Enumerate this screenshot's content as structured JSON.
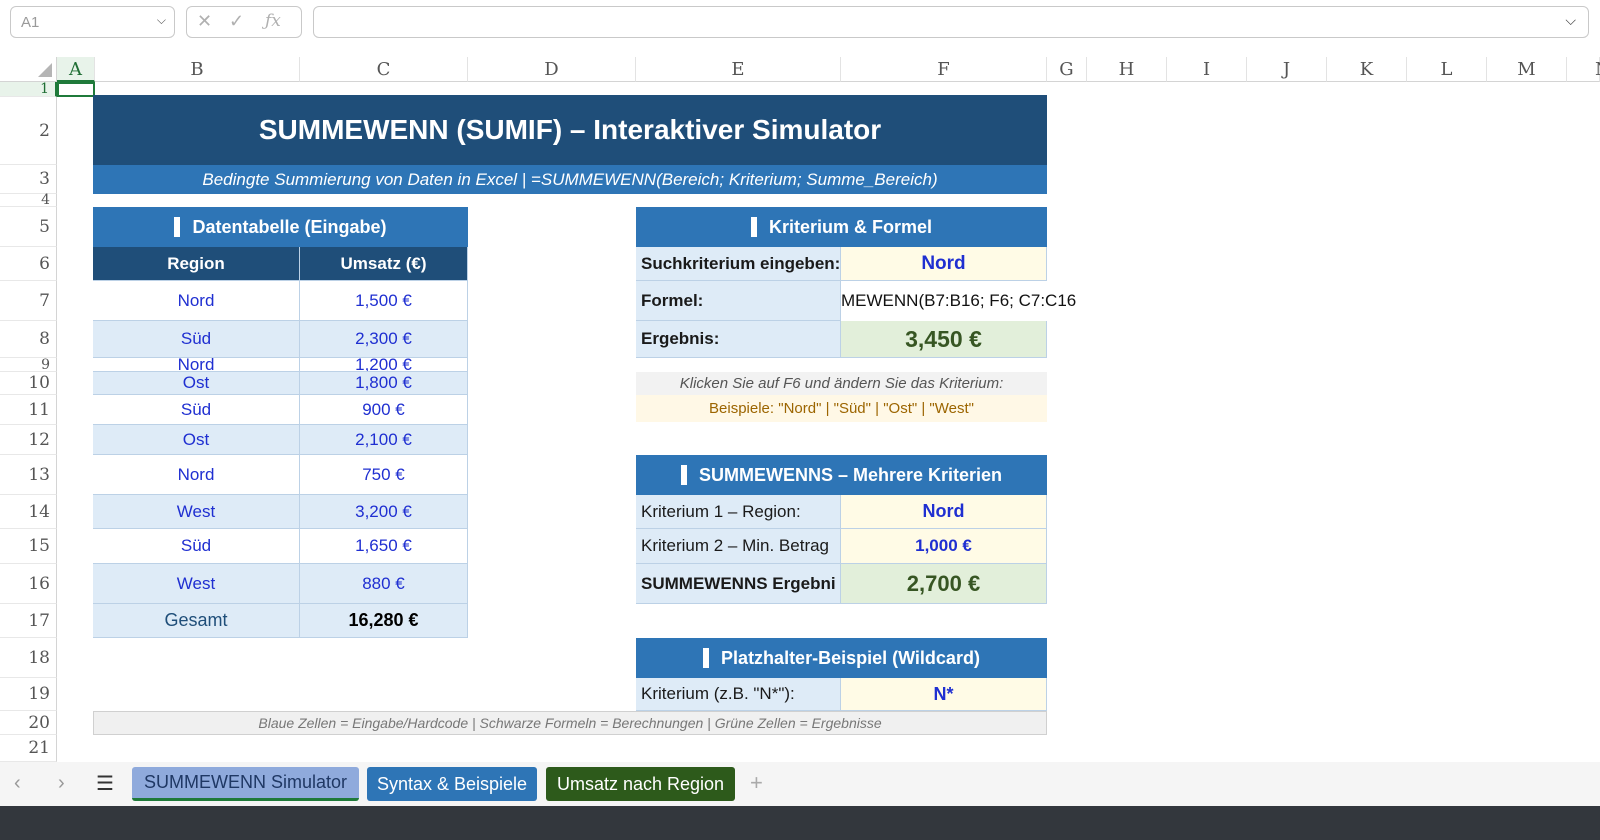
{
  "formula_bar": {
    "name_box": "A1",
    "formula": ""
  },
  "columns": [
    "A",
    "B",
    "C",
    "D",
    "E",
    "F",
    "G",
    "H",
    "I",
    "J",
    "K",
    "L",
    "M",
    "N"
  ],
  "rows": [
    "1",
    "2",
    "3",
    "4",
    "5",
    "6",
    "7",
    "8",
    "9",
    "10",
    "11",
    "12",
    "13",
    "14",
    "15",
    "16",
    "17",
    "18",
    "19",
    "20",
    "21"
  ],
  "title": "SUMMEWENN (SUMIF) – Interaktiver Simulator",
  "subtitle": "Bedingte Summierung von Daten in Excel  |  =SUMMEWENN(Bereich; Kriterium; Summe_Bereich)",
  "data_table": {
    "heading": "Datentabelle (Eingabe)",
    "col_region": "Region",
    "col_umsatz": "Umsatz (€)",
    "rows": [
      {
        "region": "Nord",
        "umsatz": "1,500 €"
      },
      {
        "region": "Süd",
        "umsatz": "2,300 €"
      },
      {
        "region": "Nord",
        "umsatz": "1,200 €"
      },
      {
        "region": "Ost",
        "umsatz": "1,800 €"
      },
      {
        "region": "Süd",
        "umsatz": "900 €"
      },
      {
        "region": "Ost",
        "umsatz": "2,100 €"
      },
      {
        "region": "Nord",
        "umsatz": "750 €"
      },
      {
        "region": "West",
        "umsatz": "3,200 €"
      },
      {
        "region": "Süd",
        "umsatz": "1,650 €"
      },
      {
        "region": "West",
        "umsatz": "880 €"
      }
    ],
    "total_label": "Gesamt",
    "total_value": "16,280 €"
  },
  "criterion_box": {
    "heading": "Kriterium & Formel",
    "search_label": "Suchkriterium eingeben:",
    "search_value": "Nord",
    "formula_label": "Formel:",
    "formula_value": "MEWENN(B7:B16; F6; C7:C16",
    "result_label": "Ergebnis:",
    "result_value": "3,450 €",
    "hint": "Klicken Sie auf F6 und ändern Sie das Kriterium:",
    "examples": "Beispiele: \"Nord\"  |  \"Süd\"  |  \"Ost\"  |  \"West\""
  },
  "multi_box": {
    "heading": "SUMMEWENNS – Mehrere Kriterien",
    "k1_label": "Kriterium 1 – Region:",
    "k1_value": "Nord",
    "k2_label": "Kriterium 2 – Min. Betrag",
    "k2_value": "1,000 €",
    "result_label": "SUMMEWENNS Ergebni",
    "result_value": "2,700 €"
  },
  "wildcard_box": {
    "heading": "Platzhalter-Beispiel (Wildcard)",
    "label": "Kriterium (z.B. \"N*\"):",
    "value": "N*"
  },
  "footnote": "Blaue Zellen = Eingabe/Hardcode  |  Schwarze Formeln = Berechnungen  |  Grüne Zellen = Ergebnisse",
  "tabs": [
    {
      "label": "SUMMEWENN Simulator"
    },
    {
      "label": "Syntax & Beispiele"
    },
    {
      "label": "Umsatz nach Region"
    }
  ],
  "colors": {
    "dark_blue": "#1f4e79",
    "mid_blue": "#2e75b6",
    "input_blue": "#1f2fd1",
    "result_green": "#e2efda",
    "tab_active": "#8faadc",
    "tab_blue": "#2e75b6",
    "tab_green": "#2d5a1b"
  }
}
